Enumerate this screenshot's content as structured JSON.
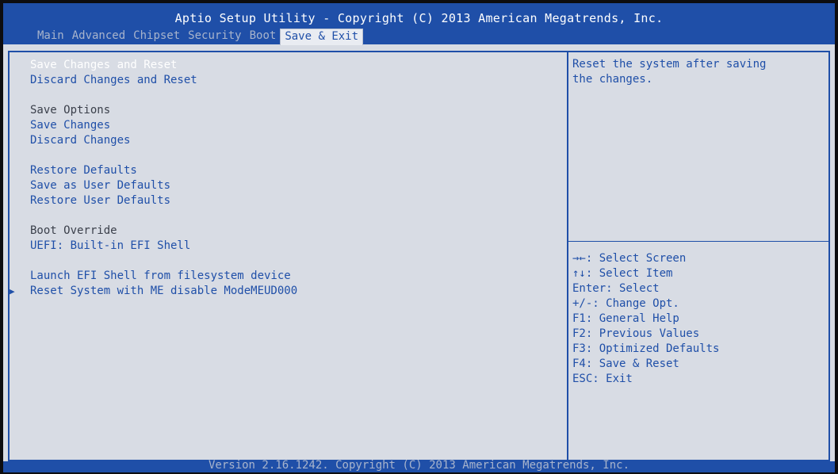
{
  "header": {
    "title": "Aptio Setup Utility - Copyright (C) 2013 American Megatrends, Inc.",
    "tabs": [
      "Main",
      "Advanced",
      "Chipset",
      "Security",
      "Boot",
      "Save & Exit"
    ],
    "active_tab": "Save & Exit"
  },
  "menu": {
    "items": [
      {
        "label": "Save Changes and Reset",
        "selected": true
      },
      {
        "label": "Discard Changes and Reset"
      },
      {
        "label": "Save Options",
        "type": "heading"
      },
      {
        "label": "Save Changes"
      },
      {
        "label": "Discard Changes"
      },
      {
        "label": "Restore Defaults"
      },
      {
        "label": "Save as User Defaults"
      },
      {
        "label": "Restore User Defaults"
      },
      {
        "label": "Boot Override",
        "type": "heading"
      },
      {
        "label": "UEFI: Built-in EFI Shell"
      },
      {
        "label": "Launch EFI Shell from filesystem device"
      },
      {
        "label": "Reset System with ME disable ModeMEUD000",
        "submenu": true
      }
    ],
    "submenu_icon": "right-triangle-icon"
  },
  "help": {
    "lines": [
      "Reset the system after saving",
      "the changes."
    ]
  },
  "keys": [
    "→←: Select Screen",
    "↑↓: Select Item",
    "Enter: Select",
    "+/-: Change Opt.",
    "F1: General Help",
    "F2: Previous Values",
    "F3: Optimized Defaults",
    "F4: Save & Reset",
    "ESC: Exit"
  ],
  "footer": {
    "text": "Version 2.16.1242. Copyright (C) 2013 American Megatrends, Inc."
  },
  "colors": {
    "accent": "#1f4fa8",
    "panel_bg": "#d8dce4",
    "selected_text": "#ffffff"
  }
}
